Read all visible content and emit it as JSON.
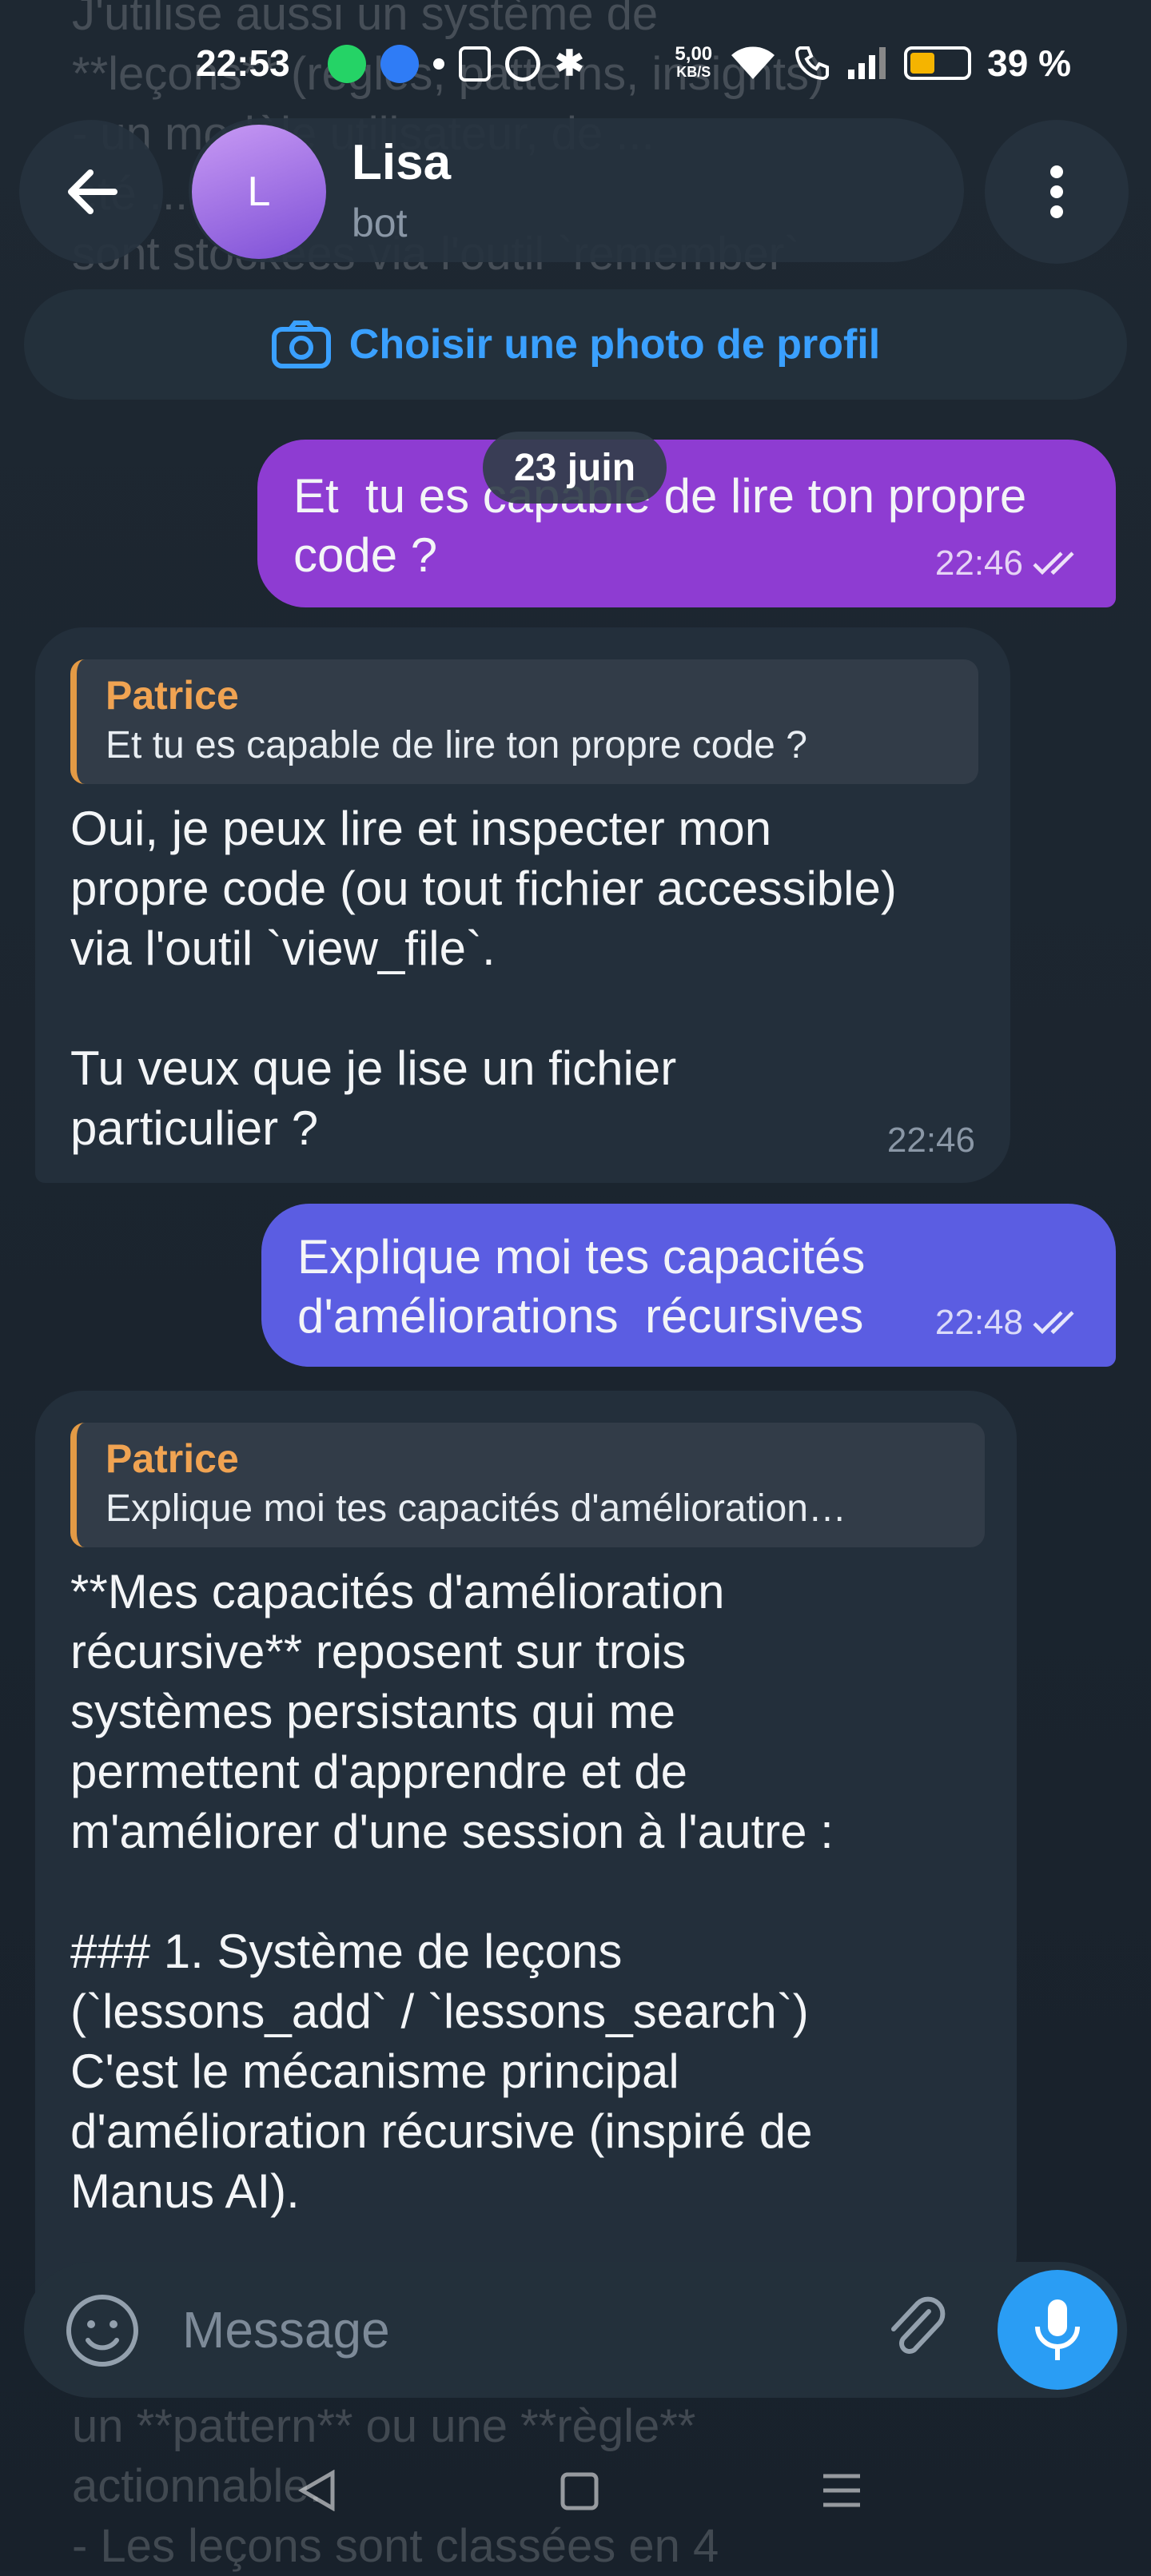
{
  "status": {
    "time": "22:53",
    "net_speed_value": "5,00",
    "net_speed_unit": "KB/S",
    "battery": "39 %"
  },
  "header": {
    "avatar_letter": "L",
    "name": "Lisa",
    "subtitle": "bot"
  },
  "banner": {
    "label": "Choisir une photo de profil"
  },
  "date_separator": "23 juin",
  "messages": [
    {
      "type": "outgoing",
      "text": "Et  tu es capable de lire ton propre\ncode ?",
      "time": "22:46"
    },
    {
      "type": "incoming",
      "reply_name": "Patrice",
      "reply_text": "Et  tu es capable de lire ton propre code ?",
      "text": "Oui, je peux lire et inspecter mon\npropre code (ou tout fichier accessible)\nvia l'outil `view_file`.\n\nTu veux que je lise un fichier\nparticulier ?",
      "time": "22:46"
    },
    {
      "type": "outgoing",
      "text": "Explique moi tes capacités\nd'améliorations  récursives",
      "time": "22:48"
    },
    {
      "type": "incoming",
      "reply_name": "Patrice",
      "reply_text": "Explique moi tes capacités d'amélioration…",
      "text": "**Mes capacités d'amélioration\nrécursive** reposent sur trois\nsystèmes persistants qui me\npermettent d'apprendre et de\nm'améliorer d'une session à l'autre :\n\n### 1. Système de leçons\n(`lessons_add` / `lessons_search`)\nC'est le mécanisme principal\nd'amélioration récursive (inspiré de\nManus AI).",
      "time": ""
    }
  ],
  "background_text_top": "J'utilise aussi un système de\n**leçons** (règles, patterns, insights)\n- un modèle utilisateur, de ...\nété ...\nsont stockées via l'outil `remember`",
  "background_text_bottom": "un **pattern** ou une **règle**\nactionnable.\n- Les leçons sont classées en 4",
  "input": {
    "placeholder": "Message"
  },
  "icons": {
    "back": "arrow-left-icon",
    "menu": "more-vertical-icon",
    "camera": "camera-icon",
    "emoji": "smiley-icon",
    "attach": "paperclip-icon",
    "mic": "microphone-icon"
  },
  "colors": {
    "outgoing_1": "#8e3cd2",
    "outgoing_2": "#5b5de2",
    "incoming": "#232f3b",
    "accent": "#2a9df4",
    "reply_name": "#f0a352"
  }
}
